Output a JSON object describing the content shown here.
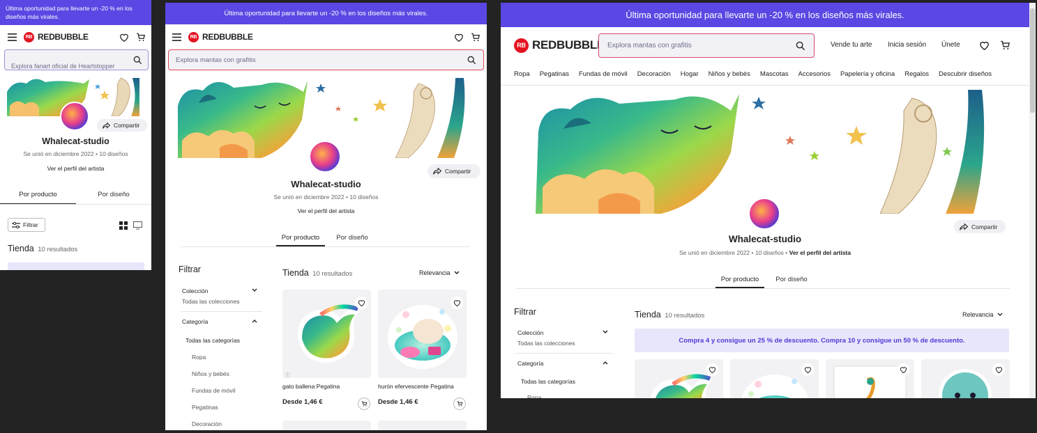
{
  "promo": {
    "text": "Última oportunidad para llevarte un -20 % en los diseños más virales."
  },
  "brand": {
    "name": "REDBUBBLE",
    "badge": "RB"
  },
  "search": {
    "placeholder_mobile": "Explora fanart oficial de Heartstopper",
    "placeholder_tablet": "Explora mantas con grafitis",
    "placeholder_desktop": "Explora mantas con grafitis"
  },
  "header": {
    "sell": "Vende tu arte",
    "login": "Inicia sesión",
    "join": "Únete"
  },
  "nav": {
    "items": [
      "Ropa",
      "Pegatinas",
      "Fundas de móvil",
      "Decoración",
      "Hogar",
      "Niños y bebés",
      "Mascotas",
      "Accesorios",
      "Papelería y oficina",
      "Regalos",
      "Descubrir diseños"
    ]
  },
  "artist": {
    "name": "Whalecat-studio",
    "joined": "Se unió en diciembre 2022",
    "designs": "10 diseños",
    "profile_link": "Ver el perfil del artista",
    "share": "Compartir"
  },
  "tabs": {
    "product": "Por producto",
    "design": "Por diseño"
  },
  "filter": {
    "button": "Filtrar",
    "heading": "Filtrar",
    "collection_label": "Colección",
    "collection_value": "Todas las colecciones",
    "category_label": "Categoría",
    "categories": [
      "Todas las categorías",
      "Ropa",
      "Niños y bebés",
      "Fundas de móvil",
      "Pegatinas",
      "Decoración"
    ]
  },
  "shop": {
    "title": "Tienda",
    "count": "10 resultados",
    "sort": "Relevancia",
    "discount": "Compra 4 y consigue un 25 % de descuento.  Compra 10 y consigue un 50 % de descuento."
  },
  "products": [
    {
      "name": "gato ballena Pegatina",
      "price": "Desde 1,46 €"
    },
    {
      "name": "hurón efervescente Pegatina",
      "price": "Desde 1,46 €"
    }
  ],
  "colors": {
    "promo": "#5b47e3",
    "brand_red": "#e41321",
    "accent_purple": "#4c3ad6",
    "discount_bg": "#e8e6fb"
  }
}
